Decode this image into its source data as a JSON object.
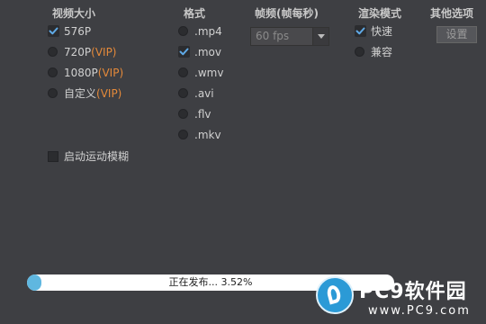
{
  "headers": {
    "video_size": "视频大小",
    "format": "格式",
    "framerate": "帧频(帧每秒)",
    "render_mode": "渲染模式",
    "other_options": "其他选项"
  },
  "video_size": [
    {
      "label": "576P",
      "vip": "",
      "checked": true
    },
    {
      "label": "720P",
      "vip": "(VIP)",
      "checked": false
    },
    {
      "label": "1080P",
      "vip": "(VIP)",
      "checked": false
    },
    {
      "label": "自定义",
      "vip": "(VIP)",
      "checked": false
    }
  ],
  "formats": [
    {
      "label": ".mp4",
      "checked": false
    },
    {
      "label": ".mov",
      "checked": true
    },
    {
      "label": ".wmv",
      "checked": false
    },
    {
      "label": ".avi",
      "checked": false
    },
    {
      "label": ".flv",
      "checked": false
    },
    {
      "label": ".mkv",
      "checked": false
    }
  ],
  "framerate": {
    "value": "60 fps"
  },
  "render_modes": [
    {
      "label": "快速",
      "checked": true
    },
    {
      "label": "兼容",
      "checked": false
    }
  ],
  "other": {
    "settings_label": "设置"
  },
  "motion_blur": {
    "label": "启动运动模糊",
    "checked": false
  },
  "progress": {
    "text": "正在发布... 3.52%",
    "value": 0.0352
  },
  "watermark": {
    "title": "PC9软件园",
    "url": "www.PC9.com"
  },
  "colors": {
    "background": "#3e3f43",
    "vip": "#e58a3a",
    "progress_fill": "#5fb7e0",
    "brand": "#2b9ad6"
  }
}
